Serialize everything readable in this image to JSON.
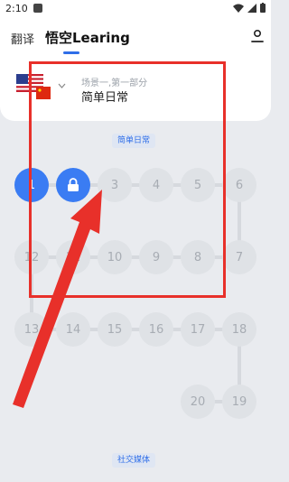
{
  "status_bar": {
    "time": "2:10"
  },
  "app_bar": {
    "translate_label": "翻译",
    "title": "悟空Learing"
  },
  "course_card": {
    "subtitle": "场景一,第一部分",
    "name": "简单日常"
  },
  "sections": [
    "简单日常",
    "社交媒体"
  ],
  "nodes": [
    "1",
    "",
    "3",
    "4",
    "5",
    "6",
    "12",
    "11",
    "10",
    "9",
    "8",
    "7",
    "13",
    "14",
    "15",
    "16",
    "17",
    "18",
    "20",
    "19"
  ],
  "colors": {
    "accent": "#3a7cf3",
    "annotation": "#e8302a"
  }
}
